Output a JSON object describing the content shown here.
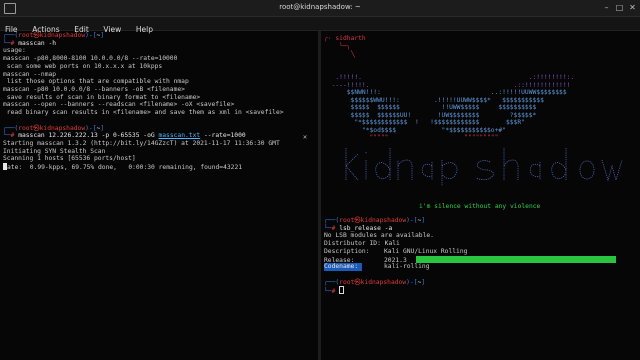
{
  "window": {
    "title": "root@kidnapshadow: ~"
  },
  "menu": [
    "File",
    "Actions",
    "Edit",
    "View",
    "Help"
  ],
  "left": {
    "prompt1_user": "root㉿kidnapshadow",
    "prompt1_path": "~",
    "cmd1": "masscan -h",
    "help_lines": [
      "usage:",
      "masscan -p80,8000-8100 10.0.0.0/8 --rate=10000",
      " scan some web ports on 10.x.x.x at 10kpps",
      "masscan --nmap",
      " list those options that are compatible with nmap",
      "masscan -p80 10.0.0.0/8 --banners -oB <filename>",
      " save results of scan in binary format to <filename>",
      "masscan --open --banners --readscan <filename> -oX <savefile>",
      " read binary scan results in <filename> and save them as xml in <savefile>"
    ],
    "prompt2_user": "root㉿kidnapshadow",
    "prompt2_path": "~",
    "cmd2_a": "masscan 12.226.222.13 -p 0-65535 -oG ",
    "cmd2_file": "masscan.txt",
    "cmd2_b": " --rate=1000",
    "output": [
      "Starting masscan 1.3.2 (http://bit.ly/14GZzcT) at 2021-11-17 11:36:30 GMT",
      "Initiating SYN Stealth Scan",
      "Scanning 1 hosts [65536 ports/host]"
    ],
    "rate_label": "rate",
    "rate_rest": ":  0.99-kpps, 69.75% done,   0:00:30 remaining, found=43221"
  },
  "right": {
    "art_top_label": "sidharth",
    "banner_text": "kidnapshadow",
    "motto": "i'm silence without any violence",
    "prompt1_user": "root㉿kidnapshadow",
    "prompt1_path": "~",
    "cmd": "lsb_release -a",
    "lsb": [
      {
        "label": "No LSB modules are available.",
        "value": ""
      },
      {
        "label": "Distributor ID:",
        "value": "Kali"
      },
      {
        "label": "Description:",
        "value": "Kali GNU/Linux Rolling"
      },
      {
        "label": "Release:",
        "value": "2021.3"
      },
      {
        "label": "Codename:",
        "value": "kali-rolling"
      }
    ],
    "prompt2_user": "root㉿kidnapshadow",
    "prompt2_path": "~"
  },
  "colors": {
    "prompt": "#3b7de6",
    "root": "#e03a3a",
    "accent": "#33d04a",
    "art": "#7b5cc9"
  }
}
